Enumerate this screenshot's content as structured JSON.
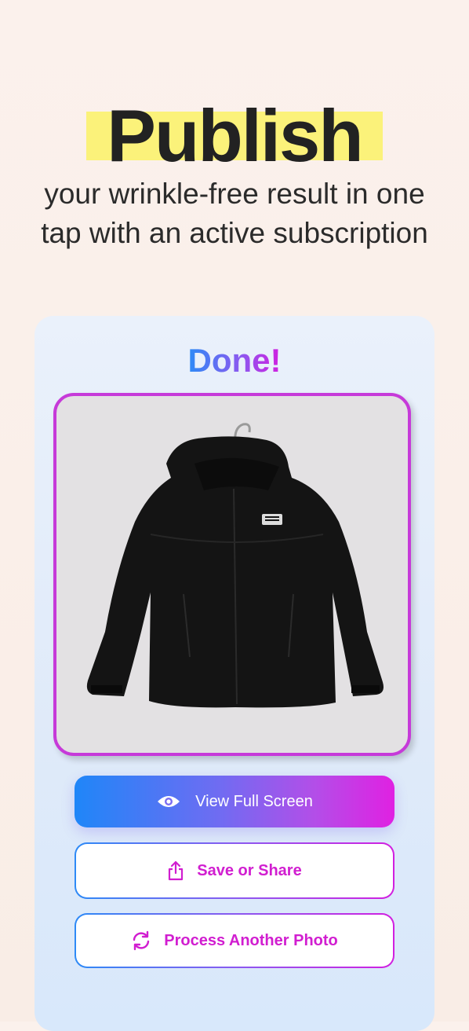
{
  "promo": {
    "headline": "Publish",
    "subtitle": "your wrinkle-free result in one tap with an active subscription"
  },
  "result": {
    "status": "Done!",
    "photo_alt": "Black hooded jacket with The North Face logo on a wooden hanger"
  },
  "actions": {
    "view_full_screen": "View Full Screen",
    "save_or_share": "Save or Share",
    "process_another": "Process Another Photo"
  },
  "colors": {
    "accent_blue": "#1f86f8",
    "accent_magenta": "#d21fe0",
    "highlight_yellow": "#fbf27a"
  },
  "icons": {
    "view": "eye-icon",
    "save": "share-icon",
    "process": "refresh-icon"
  }
}
